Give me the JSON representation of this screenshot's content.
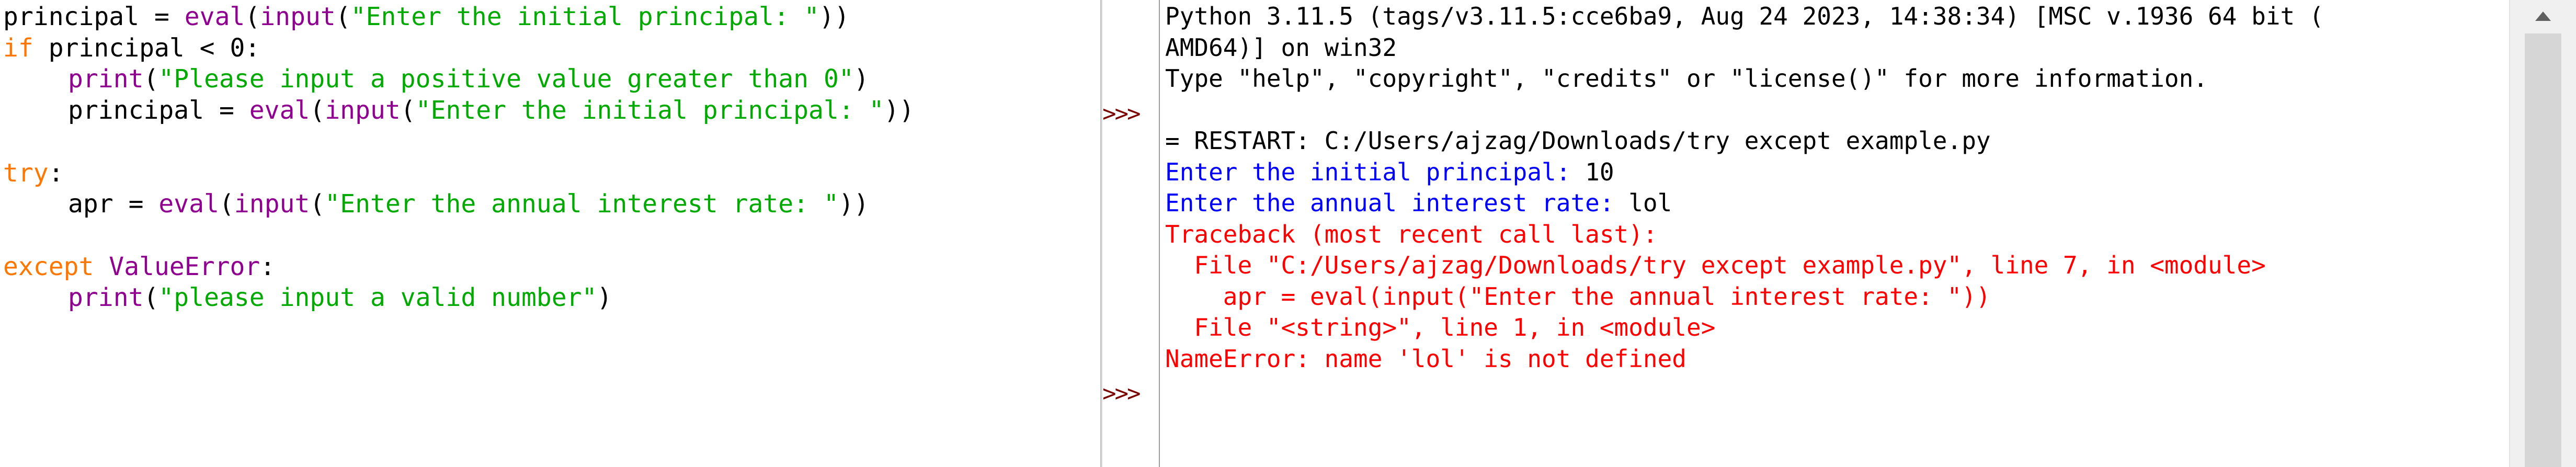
{
  "editor": {
    "lines": [
      {
        "indent": false,
        "tokens": [
          {
            "text": "principal = ",
            "cls": "plain"
          },
          {
            "text": "eval",
            "cls": "bi"
          },
          {
            "text": "(",
            "cls": "plain"
          },
          {
            "text": "input",
            "cls": "bi"
          },
          {
            "text": "(",
            "cls": "plain"
          },
          {
            "text": "\"Enter the initial principal: \"",
            "cls": "str"
          },
          {
            "text": "))",
            "cls": "plain"
          }
        ]
      },
      {
        "indent": false,
        "tokens": [
          {
            "text": "if",
            "cls": "kw"
          },
          {
            "text": " principal < 0:",
            "cls": "plain"
          }
        ]
      },
      {
        "indent": true,
        "tokens": [
          {
            "text": "print",
            "cls": "bi"
          },
          {
            "text": "(",
            "cls": "plain"
          },
          {
            "text": "\"Please input a positive value greater than 0\"",
            "cls": "str"
          },
          {
            "text": ")",
            "cls": "plain"
          }
        ]
      },
      {
        "indent": true,
        "tokens": [
          {
            "text": "principal = ",
            "cls": "plain"
          },
          {
            "text": "eval",
            "cls": "bi"
          },
          {
            "text": "(",
            "cls": "plain"
          },
          {
            "text": "input",
            "cls": "bi"
          },
          {
            "text": "(",
            "cls": "plain"
          },
          {
            "text": "\"Enter the initial principal: \"",
            "cls": "str"
          },
          {
            "text": "))",
            "cls": "plain"
          }
        ]
      },
      {
        "indent": false,
        "tokens": []
      },
      {
        "indent": false,
        "tokens": [
          {
            "text": "try",
            "cls": "kw"
          },
          {
            "text": ":",
            "cls": "plain"
          }
        ]
      },
      {
        "indent": true,
        "tokens": [
          {
            "text": "apr = ",
            "cls": "plain"
          },
          {
            "text": "eval",
            "cls": "bi"
          },
          {
            "text": "(",
            "cls": "plain"
          },
          {
            "text": "input",
            "cls": "bi"
          },
          {
            "text": "(",
            "cls": "plain"
          },
          {
            "text": "\"Enter the annual interest rate: \"",
            "cls": "str"
          },
          {
            "text": "))",
            "cls": "plain"
          }
        ]
      },
      {
        "indent": false,
        "tokens": []
      },
      {
        "indent": false,
        "tokens": [
          {
            "text": "except",
            "cls": "kw"
          },
          {
            "text": " ",
            "cls": "plain"
          },
          {
            "text": "ValueError",
            "cls": "bi"
          },
          {
            "text": ":",
            "cls": "plain"
          }
        ]
      },
      {
        "indent": true,
        "tokens": [
          {
            "text": "print",
            "cls": "bi"
          },
          {
            "text": "(",
            "cls": "plain"
          },
          {
            "text": "\"please input a valid number\"",
            "cls": "str"
          },
          {
            "text": ")",
            "cls": "plain"
          }
        ]
      }
    ]
  },
  "shell": {
    "prompt_marker": ">>>",
    "lines": [
      {
        "text": "Python 3.11.5 (tags/v3.11.5:cce6ba9, Aug 24 2023, 14:38:34) [MSC v.1936 64 bit (",
        "cls": "plain",
        "prompt": false
      },
      {
        "text": "AMD64)] on win32",
        "cls": "plain",
        "prompt": false
      },
      {
        "text": "Type \"help\", \"copyright\", \"credits\" or \"license()\" for more information.",
        "cls": "plain",
        "prompt": false
      },
      {
        "text": "",
        "cls": "plain",
        "prompt": true
      },
      {
        "text": "= RESTART: C:/Users/ajzag/Downloads/try except example.py",
        "cls": "plain",
        "prompt": false
      },
      {
        "text": "Enter the initial principal: ",
        "cls": "stdin",
        "prompt": false,
        "input": "10"
      },
      {
        "text": "Enter the annual interest rate: ",
        "cls": "stdin",
        "prompt": false,
        "input": "lol"
      },
      {
        "text": "Traceback (most recent call last):",
        "cls": "err",
        "prompt": false
      },
      {
        "text": "  File \"C:/Users/ajzag/Downloads/try except example.py\", line 7, in <module>",
        "cls": "err",
        "prompt": false
      },
      {
        "text": "    apr = eval(input(\"Enter the annual interest rate: \"))",
        "cls": "err",
        "prompt": false
      },
      {
        "text": "  File \"<string>\", line 1, in <module>",
        "cls": "err",
        "prompt": false
      },
      {
        "text": "NameError: name 'lol' is not defined",
        "cls": "err",
        "prompt": false
      },
      {
        "text": "",
        "cls": "plain",
        "prompt": true
      }
    ]
  },
  "scrollbar": {
    "up_arrow_icon": "triangle-up-icon"
  },
  "colors": {
    "keyword": "#ff7700",
    "builtin": "#900090",
    "string": "#00aa00",
    "stdin": "#0000ff",
    "stderr": "#ff0000",
    "prompt": "#7a0000"
  }
}
